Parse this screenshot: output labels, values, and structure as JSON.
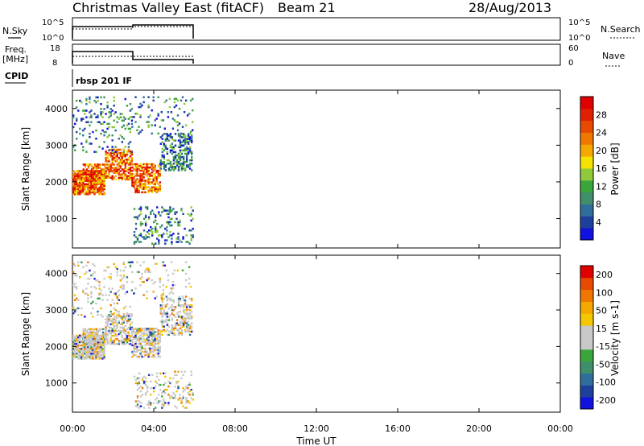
{
  "header": {
    "station": "Christmas Valley East (fitACF)",
    "beam": "Beam 21",
    "date": "28/Aug/2013"
  },
  "panel_labels": {
    "nsky": "N.Sky",
    "nsearch": "N.Search",
    "freq_line1": "Freq.",
    "freq_line2": "[MHz]",
    "nave": "Nave",
    "cpid": "CPID",
    "cpid_value": "rbsp 201 IF"
  },
  "axis_labels": {
    "nsky_left": [
      "10^5",
      "10^0"
    ],
    "nsky_right": [
      "10^5",
      "10^0"
    ],
    "freq_left": [
      "18",
      "8"
    ],
    "freq_right": [
      "60",
      "0"
    ]
  },
  "colors": {
    "power_scale": [
      "#1010e0",
      "#1e3f9c",
      "#2f6e9c",
      "#3f8f6a",
      "#3aa63a",
      "#8fca3a",
      "#f4e200",
      "#f5a800",
      "#f07800",
      "#e84a00",
      "#e02000",
      "#e00000"
    ],
    "velocity_scale": [
      "#e00000",
      "#e84a00",
      "#f07800",
      "#f5a800",
      "#f4c800",
      "#c8c8c8",
      "#c8c8c8",
      "#3aa63a",
      "#3f8f6a",
      "#2f6e9c",
      "#1e3f9c",
      "#1010e0"
    ]
  },
  "chart_data": [
    {
      "type": "heatmap",
      "name": "Power",
      "ylabel": "Slant Range [km]",
      "colorbar_label": "Power [dB]",
      "yticks": [
        1000,
        2000,
        3000,
        4000
      ],
      "colorbar_ticks": [
        "4",
        "8",
        "12",
        "16",
        "20",
        "24",
        "28"
      ],
      "ylim": [
        200,
        4500
      ],
      "xlim": [
        0,
        24
      ]
    },
    {
      "type": "heatmap",
      "name": "Velocity",
      "ylabel": "Slant Range [km]",
      "colorbar_label": "Velocity [m s-1]",
      "yticks": [
        1000,
        2000,
        3000,
        4000
      ],
      "colorbar_ticks": [
        "200",
        "100",
        "50",
        "15",
        "-15",
        "-50",
        "-100",
        "-200"
      ],
      "ylim": [
        200,
        4500
      ],
      "xlim": [
        0,
        24
      ],
      "xlabel": "Time UT",
      "xticks": [
        "00:00",
        "04:00",
        "08:00",
        "12:00",
        "16:00",
        "20:00",
        "00:00"
      ]
    }
  ]
}
